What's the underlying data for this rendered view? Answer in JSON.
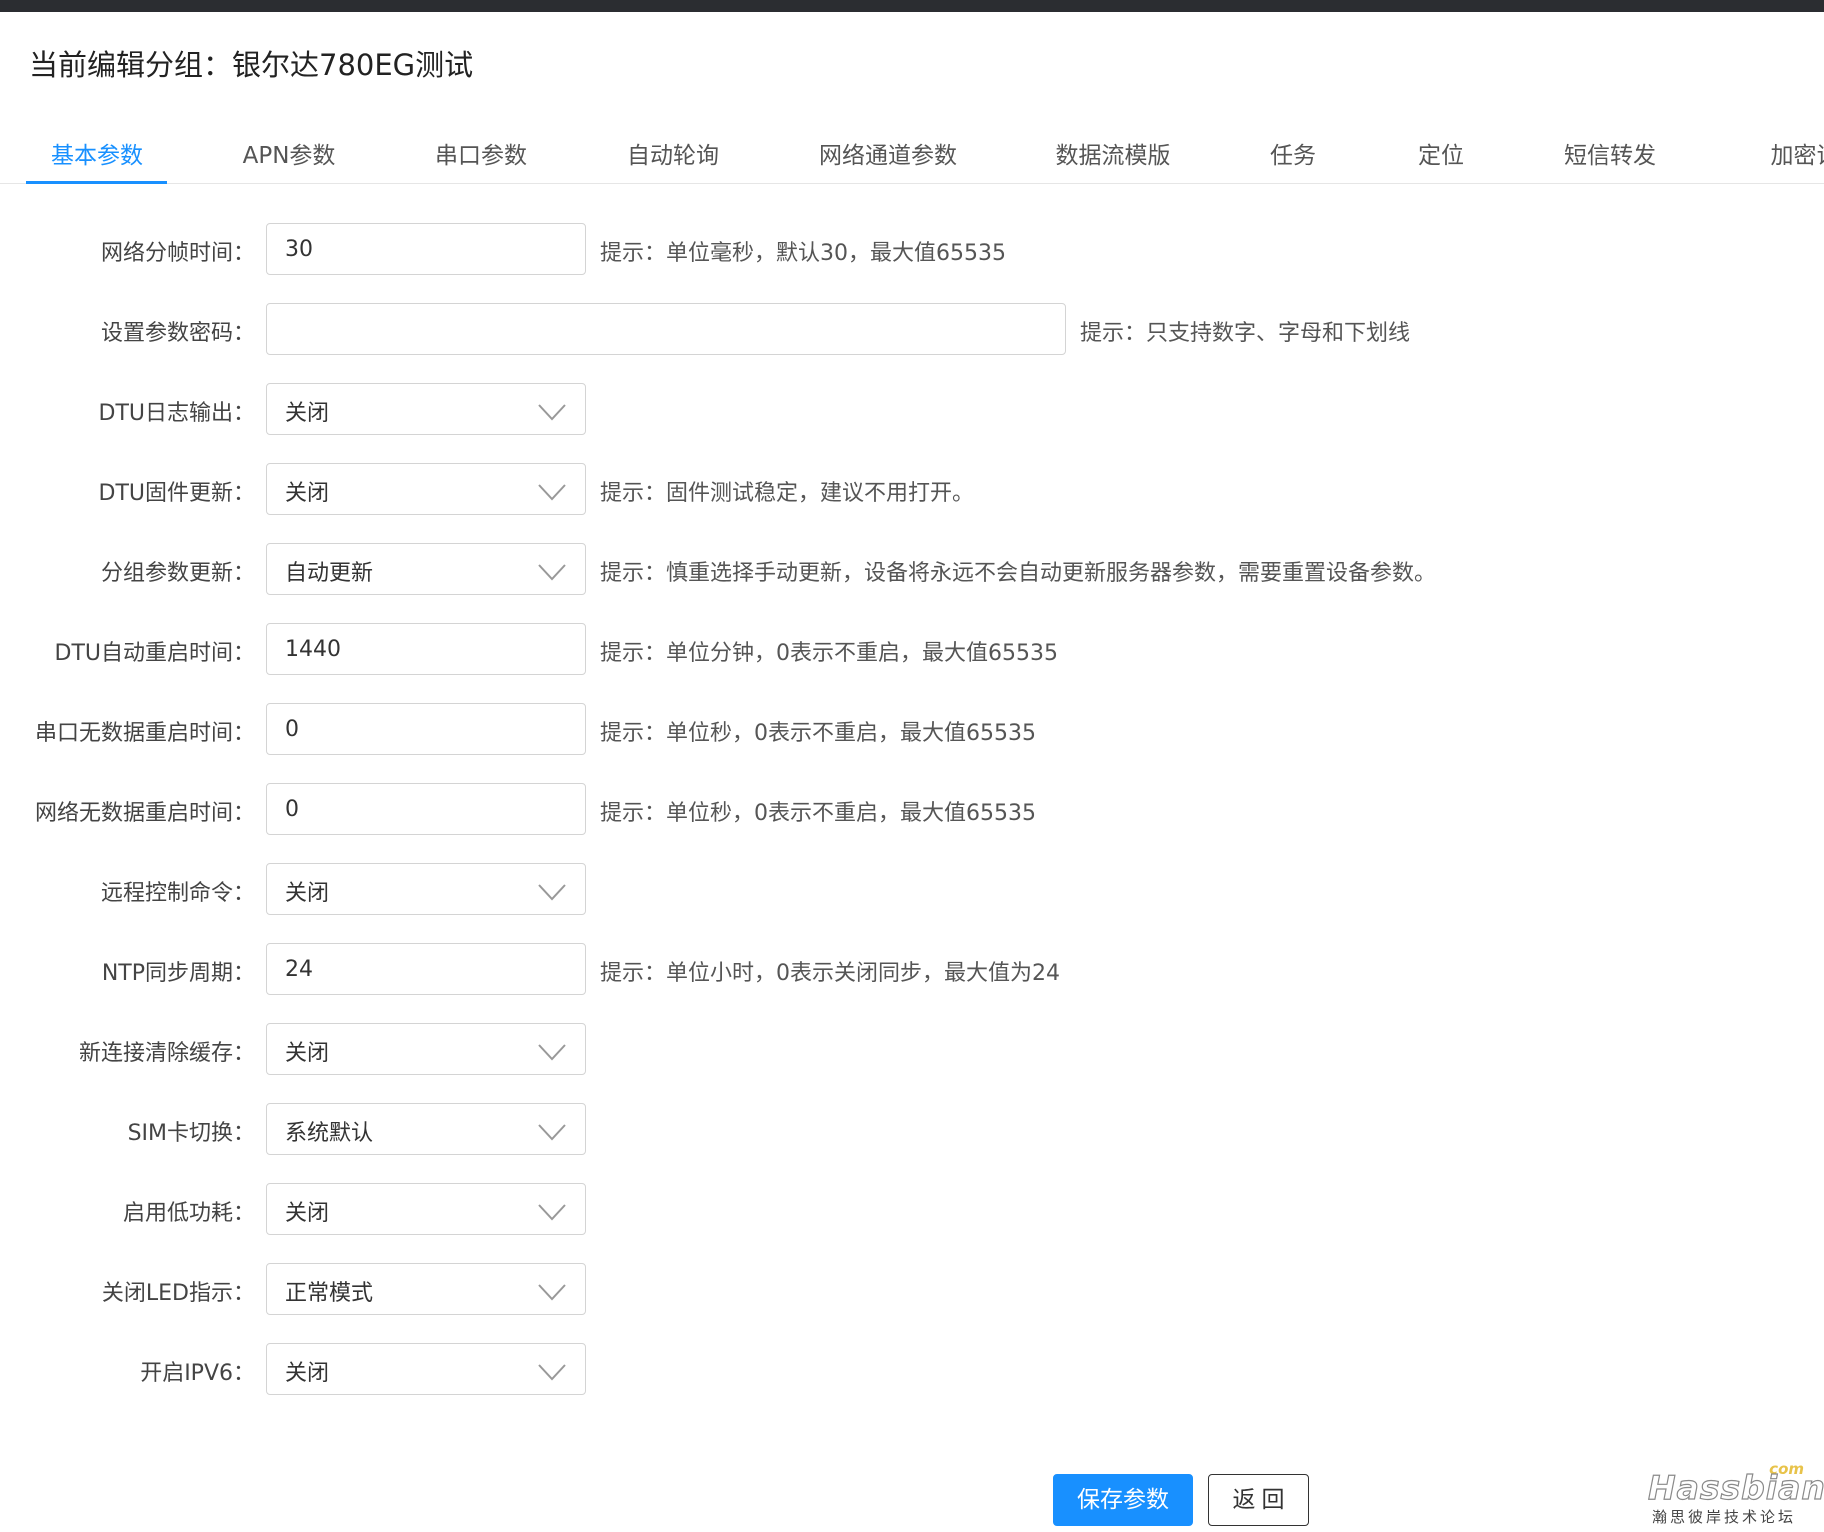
{
  "header": {
    "title": "当前编辑分组：银尔达780EG测试"
  },
  "tabs": [
    {
      "label": "基本参数",
      "active": true
    },
    {
      "label": "APN参数",
      "active": false
    },
    {
      "label": "串口参数",
      "active": false
    },
    {
      "label": "自动轮询",
      "active": false
    },
    {
      "label": "网络通道参数",
      "active": false
    },
    {
      "label": "数据流模版",
      "active": false
    },
    {
      "label": "任务",
      "active": false
    },
    {
      "label": "定位",
      "active": false
    },
    {
      "label": "短信转发",
      "active": false
    },
    {
      "label": "加密证",
      "active": false
    }
  ],
  "form": {
    "net_frame_time": {
      "label": "网络分帧时间：",
      "value": "30",
      "hint": "提示：单位毫秒，默认30，最大值65535"
    },
    "param_password": {
      "label": "设置参数密码：",
      "value": "",
      "hint": "提示：只支持数字、字母和下划线"
    },
    "dtu_log_output": {
      "label": "DTU日志输出：",
      "value": "关闭"
    },
    "dtu_firmware_update": {
      "label": "DTU固件更新：",
      "value": "关闭",
      "hint": "提示：固件测试稳定，建议不用打开。"
    },
    "group_param_update": {
      "label": "分组参数更新：",
      "value": "自动更新",
      "hint": "提示：慎重选择手动更新，设备将永远不会自动更新服务器参数，需要重置设备参数。"
    },
    "dtu_auto_restart": {
      "label": "DTU自动重启时间：",
      "value": "1440",
      "hint": "提示：单位分钟，0表示不重启，最大值65535"
    },
    "serial_no_data_restart": {
      "label": "串口无数据重启时间：",
      "value": "0",
      "hint": "提示：单位秒，0表示不重启，最大值65535"
    },
    "net_no_data_restart": {
      "label": "网络无数据重启时间：",
      "value": "0",
      "hint": "提示：单位秒，0表示不重启，最大值65535"
    },
    "remote_control": {
      "label": "远程控制命令：",
      "value": "关闭"
    },
    "ntp_sync": {
      "label": "NTP同步周期：",
      "value": "24",
      "hint": "提示：单位小时，0表示关闭同步，最大值为24"
    },
    "clear_cache": {
      "label": "新连接清除缓存：",
      "value": "关闭"
    },
    "sim_switch": {
      "label": "SIM卡切换：",
      "value": "系统默认"
    },
    "low_power": {
      "label": "启用低功耗：",
      "value": "关闭"
    },
    "led_off": {
      "label": "关闭LED指示：",
      "value": "正常模式"
    },
    "ipv6": {
      "label": "开启IPV6：",
      "value": "关闭"
    }
  },
  "buttons": {
    "save": "保存参数",
    "back": "返回"
  },
  "watermark": {
    "com": "com",
    "brand": "Hassbian",
    "sub": "瀚思彼岸技术论坛"
  },
  "colors": {
    "accent": "#1890ff"
  }
}
